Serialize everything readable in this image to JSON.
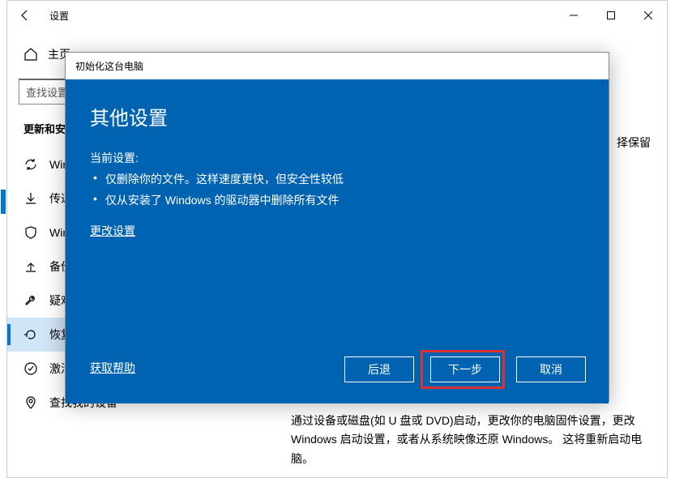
{
  "window": {
    "title": "设置",
    "controls": {
      "minimize": "min",
      "maximize": "max",
      "close": "x"
    }
  },
  "sidebar": {
    "home_label": "主页",
    "search_placeholder": "查找设置",
    "section_title": "更新和安全",
    "items": [
      {
        "label": "Windows 更新"
      },
      {
        "label": "传递优化"
      },
      {
        "label": "Windows 安全中心"
      },
      {
        "label": "备份"
      },
      {
        "label": "疑难解答"
      },
      {
        "label": "恢复"
      },
      {
        "label": "激活"
      },
      {
        "label": "查找我的设备"
      }
    ]
  },
  "content": {
    "right_snippet": "择保留",
    "bottom_paragraph": "通过设备或磁盘(如 U 盘或 DVD)启动，更改你的电脑固件设置，更改 Windows 启动设置，或者从系统映像还原 Windows。  这将重新启动电脑。"
  },
  "dialog": {
    "title": "初始化这台电脑",
    "heading": "其他设置",
    "current_label": "当前设置:",
    "bullets": [
      "仅删除你的文件。这样速度更快，但安全性较低",
      "仅从安装了 Windows 的驱动器中删除所有文件"
    ],
    "change_link": "更改设置",
    "help_link": "获取帮助",
    "buttons": {
      "back": "后退",
      "next": "下一步",
      "cancel": "取消"
    }
  }
}
